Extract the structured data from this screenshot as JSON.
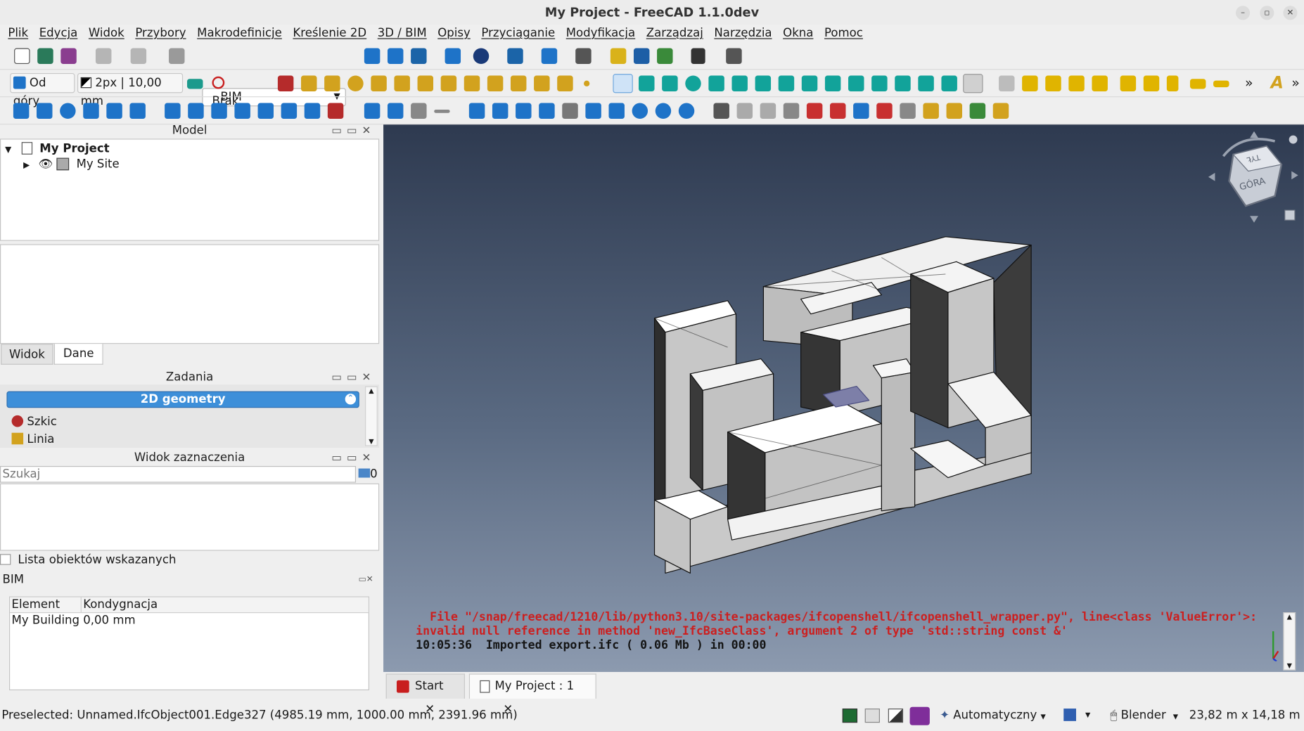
{
  "window": {
    "title": "My Project - FreeCAD 1.1.0dev"
  },
  "menu": [
    "Plik",
    "Edycja",
    "Widok",
    "Przybory",
    "Makrodefinicje",
    "Kreślenie 2D",
    "3D / BIM",
    "Opisy",
    "Przyciąganie",
    "Modyfikacja",
    "Zarządzaj",
    "Narzędzia",
    "Okna",
    "Pomoc"
  ],
  "toolbar": {
    "workbench": "BIM",
    "working_plane": "Od góry",
    "line_style": "2px | 10,00 mm",
    "snap_mode": "Brak"
  },
  "model_panel": {
    "title": "Model",
    "tree": [
      {
        "label": "My Project",
        "bold": true,
        "expanded": true
      },
      {
        "label": "My Site",
        "bold": false,
        "expanded": false
      }
    ],
    "tabs": [
      "Widok",
      "Dane"
    ],
    "active_tab": "Dane"
  },
  "tasks_panel": {
    "title": "Zadania",
    "group": "2D geometry",
    "items": [
      "Szkic",
      "Linia"
    ]
  },
  "selection_panel": {
    "title": "Widok zaznaczenia",
    "search_placeholder": "Szukaj",
    "count": "0",
    "checkbox_label": "Lista obiektów wskazanych"
  },
  "bim_panel": {
    "title": "BIM",
    "columns": [
      "Element",
      "Kondygnacja"
    ],
    "rows": [
      [
        "My Building",
        "0,00 mm"
      ]
    ]
  },
  "navcube": {
    "face_label": "GÓRA",
    "top_label": "TYŁ"
  },
  "console": {
    "lines": [
      {
        "text": "  File \"/snap/freecad/1210/lib/python3.10/site-packages/ifcopenshell/ifcopenshell_wrapper.py\", line<class 'ValueError'>:",
        "kind": "err"
      },
      {
        "text": "invalid null reference in method 'new_IfcBaseClass', argument 2 of type 'std::string const &'",
        "kind": "err"
      },
      {
        "text": "10:05:36  Imported export.ifc ( 0.06 Mb ) in 00:00",
        "kind": "ok"
      }
    ]
  },
  "doc_tabs": [
    {
      "label": "Start",
      "active": false
    },
    {
      "label": "My Project : 1",
      "active": true
    }
  ],
  "statusbar": {
    "message": "Preselected: Unnamed.IfcObject001.Edge327 (4985.19 mm, 1000.00 mm, 2391.96 mm)",
    "draw_style": "Automatyczny",
    "navigation": "Blender",
    "dimensions": "23,82 m x 14,18 m"
  },
  "colors": {
    "accent_header": "#3d8fd9",
    "error_text": "#cc1f1f",
    "viewport_top": "#2e3a50",
    "viewport_bottom": "#8c9aaf"
  }
}
